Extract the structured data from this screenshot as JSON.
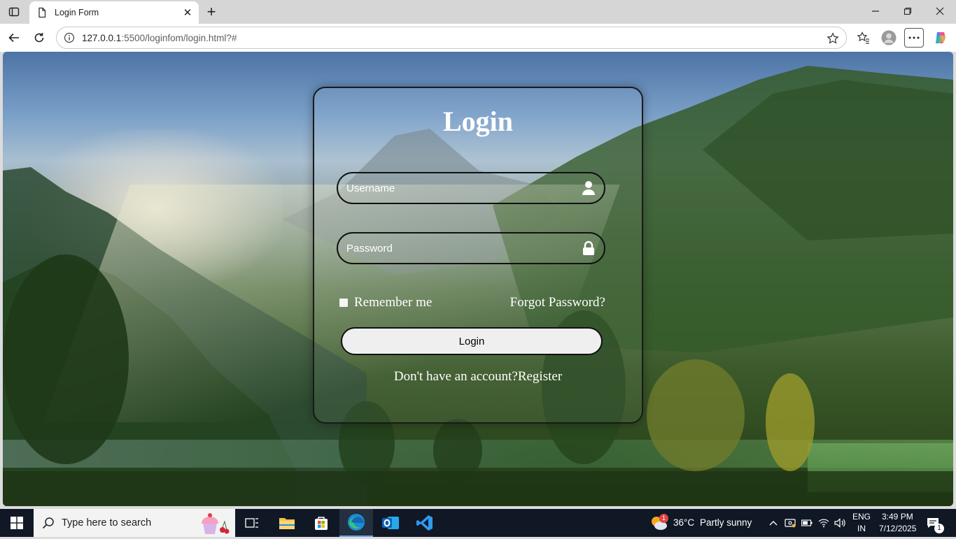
{
  "browser": {
    "tab": {
      "title": "Login Form"
    },
    "address": {
      "host": "127.0.0.1",
      "path": ":5500/loginfom/login.html?#"
    }
  },
  "page": {
    "title": "Login",
    "username": {
      "placeholder": "Username"
    },
    "password": {
      "placeholder": "Password"
    },
    "remember_label": "Remember me",
    "forgot_label": "Forgot Password?",
    "login_button": "Login",
    "register_prompt": "Don't have an account?",
    "register_link": "Register"
  },
  "taskbar": {
    "search_placeholder": "Type here to search",
    "weather": {
      "temp": "36°C",
      "condition": "Partly sunny",
      "badge": "1"
    },
    "language": {
      "line1": "ENG",
      "line2": "IN"
    },
    "clock": {
      "time": "3:49 PM",
      "date": "7/12/2025"
    },
    "notifications_count": "1"
  },
  "colors": {
    "taskbar": "#101826",
    "tab_strip": "#d6d6d6",
    "card_border": "#1a1a1a",
    "login_button_bg": "#efefef"
  }
}
